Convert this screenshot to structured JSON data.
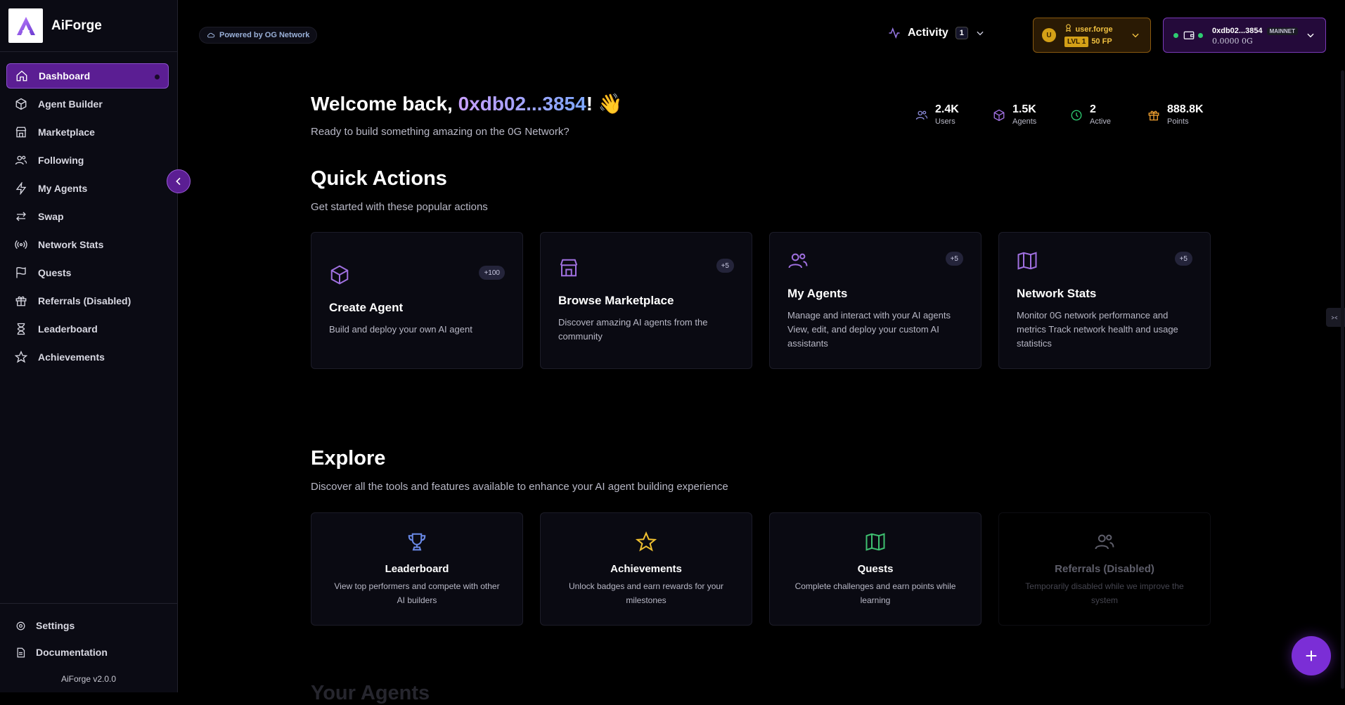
{
  "app": {
    "name": "AiForge",
    "version": "AiForge v2.0.0"
  },
  "sidebar": {
    "items": [
      {
        "label": "Dashboard",
        "icon": "home-icon",
        "active": true
      },
      {
        "label": "Agent Builder",
        "icon": "cube-icon"
      },
      {
        "label": "Marketplace",
        "icon": "store-icon"
      },
      {
        "label": "Following",
        "icon": "users-icon"
      },
      {
        "label": "My Agents",
        "icon": "lightning-icon"
      },
      {
        "label": "Swap",
        "icon": "swap-icon"
      },
      {
        "label": "Network Stats",
        "icon": "radio-icon"
      },
      {
        "label": "Quests",
        "icon": "flag-icon"
      },
      {
        "label": "Referrals (Disabled)",
        "icon": "gift-icon"
      },
      {
        "label": "Leaderboard",
        "icon": "hourglass-icon"
      },
      {
        "label": "Achievements",
        "icon": "star-icon"
      }
    ],
    "bottom": [
      {
        "label": "Settings",
        "icon": "gear-icon"
      },
      {
        "label": "Documentation",
        "icon": "document-icon"
      }
    ]
  },
  "header": {
    "powered_by": "Powered by OG Network",
    "activity_label": "Activity",
    "activity_count": "1",
    "user": {
      "avatar": "U",
      "name": "user.forge",
      "level": "LVL 1",
      "points": "50 FP"
    },
    "wallet": {
      "address": "0xdb02...3854",
      "network": "MAINNET",
      "balance": "0.0000 0G"
    }
  },
  "welcome": {
    "prefix": "Welcome back, ",
    "address": "0xdb02...3854",
    "suffix": "! 👋",
    "subtitle": "Ready to build something amazing on the 0G Network?"
  },
  "stats": [
    {
      "value": "2.4K",
      "label": "Users",
      "icon": "users-icon",
      "color": "#8a8ad8"
    },
    {
      "value": "1.5K",
      "label": "Agents",
      "icon": "cube-icon",
      "color": "#a070e0"
    },
    {
      "value": "2",
      "label": "Active",
      "icon": "clock-icon",
      "color": "#2ecc71"
    },
    {
      "value": "888.8K",
      "label": "Points",
      "icon": "gift-icon",
      "color": "#f0a030"
    }
  ],
  "quick_actions": {
    "title": "Quick Actions",
    "subtitle": "Get started with these popular actions",
    "cards": [
      {
        "title": "Create Agent",
        "desc": "Build and deploy your own AI agent",
        "points": "+100",
        "icon": "cube-icon"
      },
      {
        "title": "Browse Marketplace",
        "desc": "Discover amazing AI agents from the community",
        "points": "+5",
        "icon": "store-icon"
      },
      {
        "title": "My Agents",
        "desc": "Manage and interact with your AI agents View, edit, and deploy your custom AI assistants",
        "points": "+5",
        "icon": "users-icon"
      },
      {
        "title": "Network Stats",
        "desc": "Monitor 0G network performance and metrics Track network health and usage statistics",
        "points": "+5",
        "icon": "map-icon"
      }
    ]
  },
  "explore": {
    "title": "Explore",
    "subtitle": "Discover all the tools and features available to enhance your AI agent building experience",
    "cards": [
      {
        "title": "Leaderboard",
        "desc": "View top performers and compete with other AI builders",
        "icon": "trophy-icon",
        "color": "#6a8ae8"
      },
      {
        "title": "Achievements",
        "desc": "Unlock badges and earn rewards for your milestones",
        "icon": "star-icon",
        "color": "#f0c030"
      },
      {
        "title": "Quests",
        "desc": "Complete challenges and earn points while learning",
        "icon": "map-icon",
        "color": "#3ec070"
      },
      {
        "title": "Referrals (Disabled)",
        "desc": "Temporarily disabled while we improve the system",
        "icon": "users-icon",
        "color": "#5e5e6a",
        "disabled": true
      }
    ]
  },
  "next_section_title": "Your Agents"
}
